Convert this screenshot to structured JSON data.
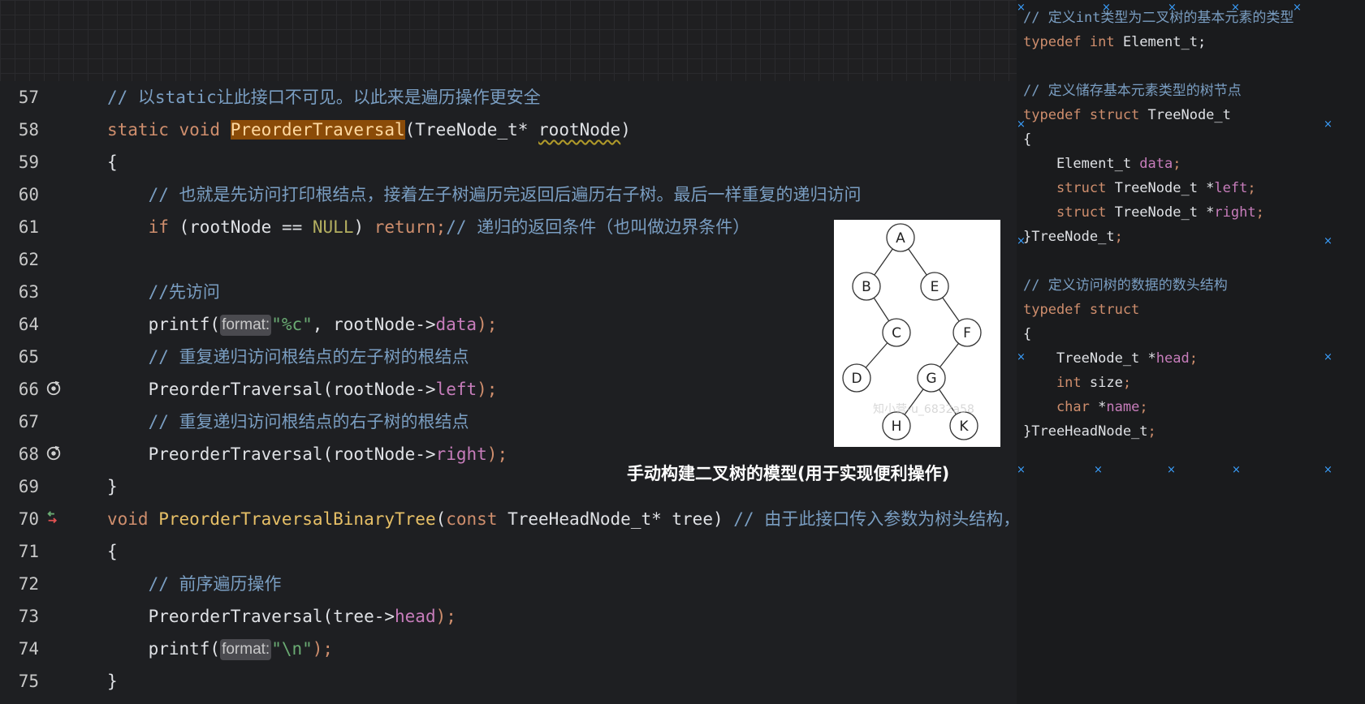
{
  "code_lines": [
    {
      "num": "57",
      "tokens": [
        {
          "c": "cmt",
          "t": "// 以static让此接口不可见。以此来是遍历操作更安全"
        }
      ]
    },
    {
      "num": "58",
      "tokens": [
        {
          "c": "kw",
          "t": "static void "
        },
        {
          "c": "fnhl",
          "t": "PreorderTraversal"
        },
        {
          "c": "typ",
          "t": "(TreeNode_t* "
        },
        {
          "c": "squig",
          "t": "rootNode"
        },
        {
          "c": "typ",
          "t": ")"
        }
      ]
    },
    {
      "num": "59",
      "tokens": [
        {
          "c": "typ",
          "t": "{"
        }
      ]
    },
    {
      "num": "60",
      "tokens": [
        {
          "c": "cmt",
          "t": "    // 也就是先访问打印根结点，接着左子树遍历完返回后遍历右子树。最后一样重复的递归访问"
        }
      ]
    },
    {
      "num": "61",
      "tokens": [
        {
          "c": "kw",
          "t": "    if "
        },
        {
          "c": "typ",
          "t": "(rootNode == "
        },
        {
          "c": "const",
          "t": "NULL"
        },
        {
          "c": "typ",
          "t": ") "
        },
        {
          "c": "kw",
          "t": "return;"
        },
        {
          "c": "cmt",
          "t": "// 递归的返回条件（也叫做边界条件）"
        }
      ]
    },
    {
      "num": "62",
      "tokens": []
    },
    {
      "num": "63",
      "tokens": [
        {
          "c": "cmt",
          "t": "    //先访问"
        }
      ]
    },
    {
      "num": "64",
      "tokens": [
        {
          "c": "typ",
          "t": "    printf("
        },
        {
          "c": "hint",
          "t": "format:"
        },
        {
          "c": "str",
          "t": "\"%c\""
        },
        {
          "c": "typ",
          "t": ", rootNode->"
        },
        {
          "c": "fld",
          "t": "data"
        },
        {
          "c": "kw",
          "t": ");"
        }
      ]
    },
    {
      "num": "65",
      "tokens": [
        {
          "c": "cmt",
          "t": "    // 重复递归访问根结点的左子树的根结点"
        }
      ]
    },
    {
      "num": "66",
      "icon": "recursion-icon",
      "tokens": [
        {
          "c": "typ",
          "t": "    PreorderTraversal(rootNode->"
        },
        {
          "c": "fld",
          "t": "left"
        },
        {
          "c": "kw",
          "t": ");"
        }
      ]
    },
    {
      "num": "67",
      "tokens": [
        {
          "c": "cmt",
          "t": "    // 重复递归访问根结点的右子树的根结点"
        }
      ]
    },
    {
      "num": "68",
      "icon": "recursion-icon",
      "tokens": [
        {
          "c": "typ",
          "t": "    PreorderTraversal(rootNode->"
        },
        {
          "c": "fld",
          "t": "right"
        },
        {
          "c": "kw",
          "t": ");"
        }
      ]
    },
    {
      "num": "69",
      "tokens": [
        {
          "c": "typ",
          "t": "}"
        }
      ]
    },
    {
      "num": "70",
      "icon": "navigation-arrows-icon",
      "tokens": [
        {
          "c": "kw",
          "t": "void "
        },
        {
          "c": "fn",
          "t": "PreorderTraversalBinaryTree"
        },
        {
          "c": "typ",
          "t": "("
        },
        {
          "c": "kw",
          "t": "const "
        },
        {
          "c": "typ",
          "t": "TreeHeadNode_t* tree) "
        },
        {
          "c": "cmt",
          "t": "// 由于此接口传入参数为树头结构，为保证安全，用const“只读”"
        }
      ]
    },
    {
      "num": "71",
      "tokens": [
        {
          "c": "typ",
          "t": "{"
        }
      ]
    },
    {
      "num": "72",
      "tokens": [
        {
          "c": "cmt",
          "t": "    // 前序遍历操作"
        }
      ]
    },
    {
      "num": "73",
      "tokens": [
        {
          "c": "typ",
          "t": "    PreorderTraversal(tree->"
        },
        {
          "c": "fld",
          "t": "head"
        },
        {
          "c": "kw",
          "t": ");"
        }
      ]
    },
    {
      "num": "74",
      "tokens": [
        {
          "c": "typ",
          "t": "    printf("
        },
        {
          "c": "hint",
          "t": "format:"
        },
        {
          "c": "str",
          "t": "\"\\n\""
        },
        {
          "c": "kw",
          "t": ");"
        }
      ]
    },
    {
      "num": "75",
      "tokens": [
        {
          "c": "typ",
          "t": "}"
        }
      ]
    }
  ],
  "snippet_lines": [
    [
      {
        "c": "cmt",
        "t": "// 定义int类型为二叉树的基本元素的类型"
      }
    ],
    [
      {
        "c": "kw",
        "t": "typedef int "
      },
      {
        "c": "typ",
        "t": "Element_t;"
      }
    ],
    [],
    [
      {
        "c": "cmt",
        "t": "// 定义储存基本元素类型的树节点"
      }
    ],
    [
      {
        "c": "kw",
        "t": "typedef struct "
      },
      {
        "c": "typ",
        "t": "TreeNode_t"
      }
    ],
    [
      {
        "c": "typ",
        "t": "{"
      }
    ],
    [
      {
        "c": "typ",
        "t": "    Element_t "
      },
      {
        "c": "fld",
        "t": "data"
      },
      {
        "c": "kw",
        "t": ";"
      }
    ],
    [
      {
        "c": "kw",
        "t": "    struct "
      },
      {
        "c": "typ",
        "t": "TreeNode_t *"
      },
      {
        "c": "fld",
        "t": "left"
      },
      {
        "c": "kw",
        "t": ";"
      }
    ],
    [
      {
        "c": "kw",
        "t": "    struct "
      },
      {
        "c": "typ",
        "t": "TreeNode_t *"
      },
      {
        "c": "fld",
        "t": "right"
      },
      {
        "c": "kw",
        "t": ";"
      }
    ],
    [
      {
        "c": "typ",
        "t": "}TreeNode_t"
      },
      {
        "c": "kw",
        "t": ";"
      }
    ],
    [],
    [
      {
        "c": "cmt",
        "t": "// 定义访问树的数据的数头结构"
      }
    ],
    [
      {
        "c": "kw",
        "t": "typedef struct"
      }
    ],
    [
      {
        "c": "typ",
        "t": "{"
      }
    ],
    [
      {
        "c": "typ",
        "t": "    TreeNode_t *"
      },
      {
        "c": "fld",
        "t": "head"
      },
      {
        "c": "kw",
        "t": ";"
      }
    ],
    [
      {
        "c": "kw",
        "t": "    int "
      },
      {
        "c": "typ",
        "t": "size"
      },
      {
        "c": "kw",
        "t": ";"
      }
    ],
    [
      {
        "c": "kw",
        "t": "    char "
      },
      {
        "c": "typ",
        "t": "*"
      },
      {
        "c": "fld",
        "t": "name"
      },
      {
        "c": "kw",
        "t": ";"
      }
    ],
    [
      {
        "c": "typ",
        "t": "}TreeHeadNode_t"
      },
      {
        "c": "kw",
        "t": ";"
      }
    ]
  ],
  "tree_figure": {
    "nodes": [
      "A",
      "B",
      "E",
      "C",
      "F",
      "D",
      "G",
      "H",
      "K"
    ],
    "watermark": "知小营-u_6832a58"
  },
  "caption": "手动构建二叉树的模型(用于实现便利操作)"
}
